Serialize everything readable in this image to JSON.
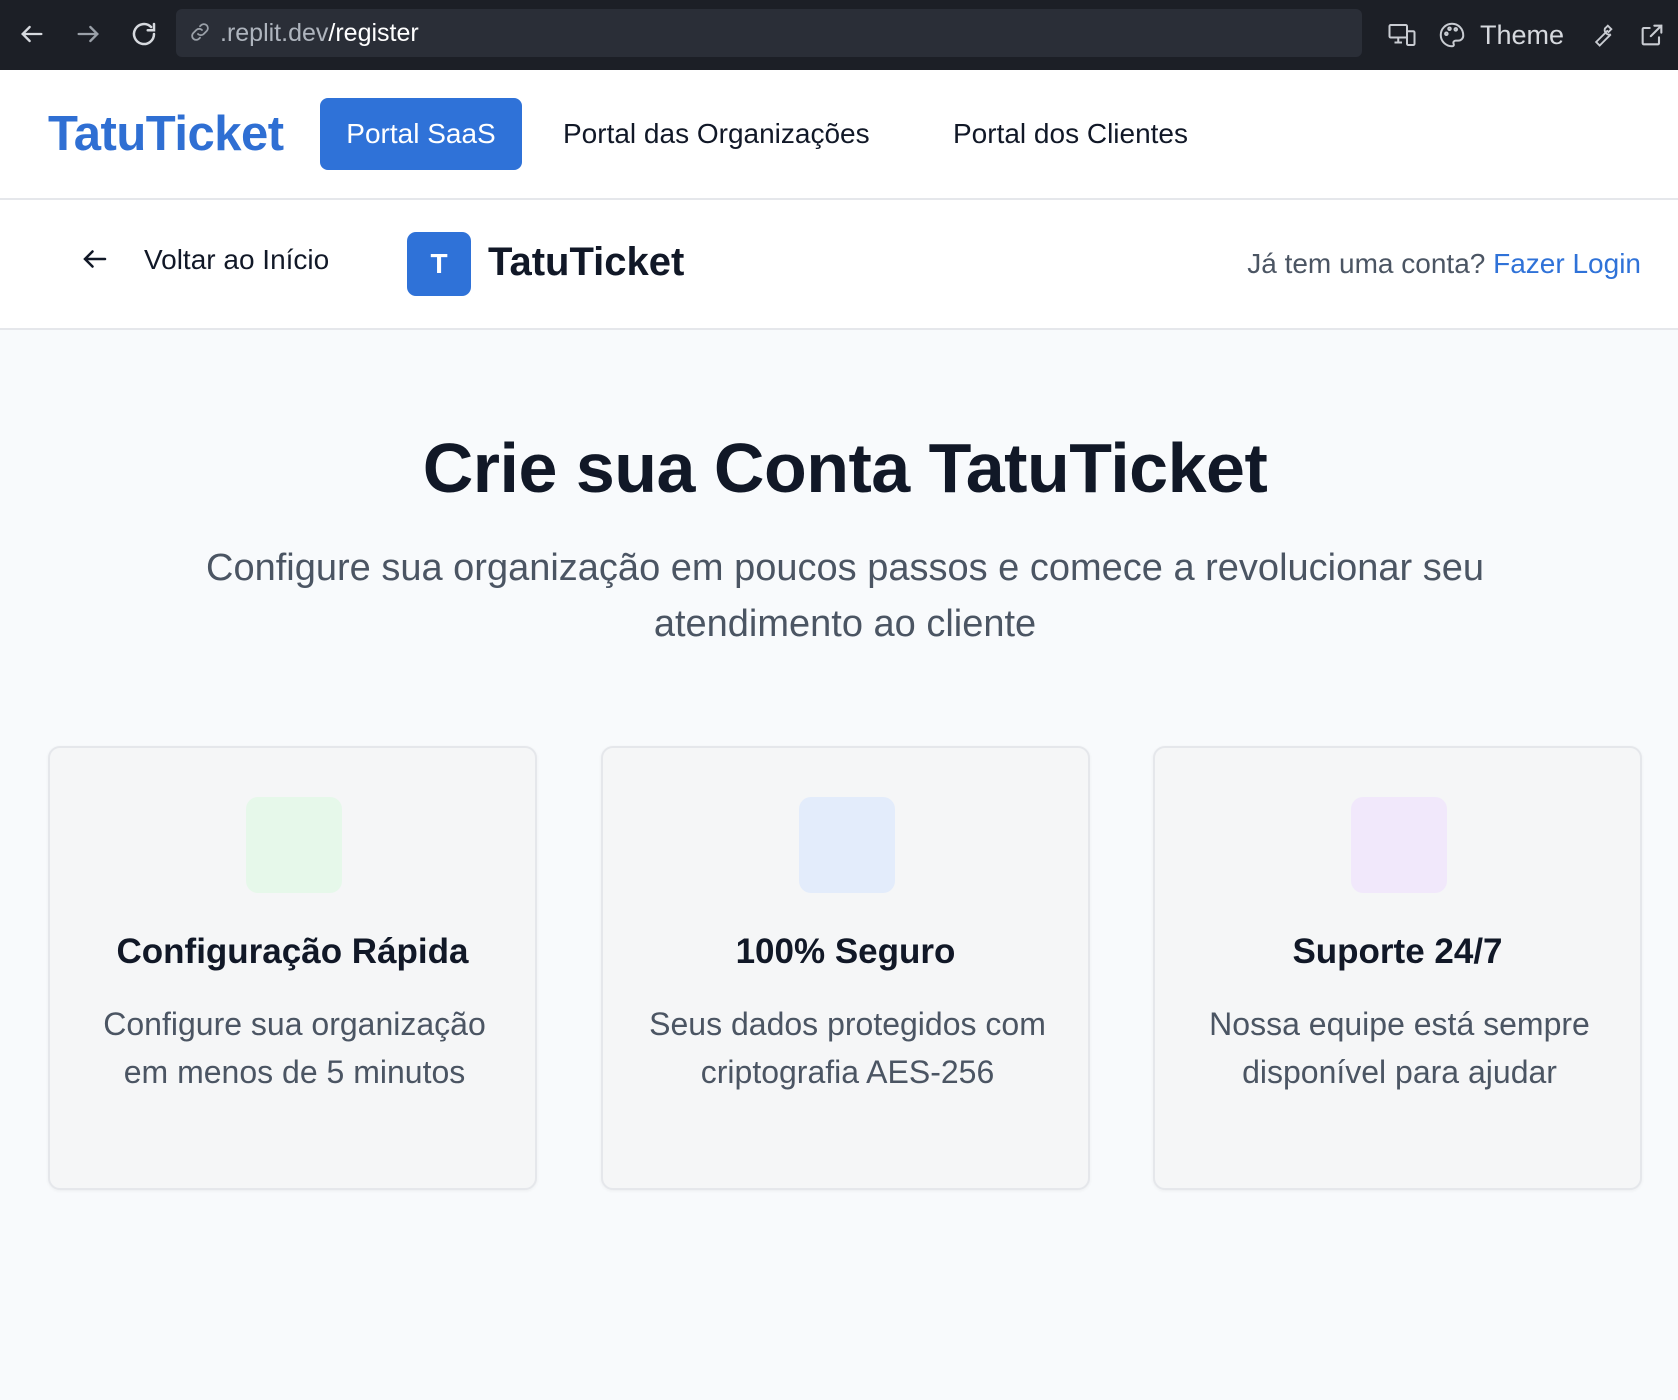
{
  "browser": {
    "url_host": ".replit.dev",
    "url_path": "/register",
    "theme_label": "Theme"
  },
  "topnav": {
    "brand": "TatuTicket",
    "tabs": [
      {
        "label": "Portal SaaS",
        "active": true
      },
      {
        "label": "Portal das Organizações",
        "active": false
      },
      {
        "label": "Portal dos Clientes",
        "active": false
      }
    ]
  },
  "subheader": {
    "back_label": "Voltar ao Início",
    "logo_letter": "T",
    "logo_text": "TatuTicket",
    "login_prompt": "Já tem uma conta?",
    "login_link": "Fazer Login"
  },
  "hero": {
    "title": "Crie sua Conta TatuTicket",
    "subtitle": "Configure sua organização em poucos passos e comece a revolucionar seu atendimento ao cliente"
  },
  "features": [
    {
      "title": "Configuração Rápida",
      "text": "Configure sua organização em menos de 5 minutos",
      "icon_bg": "#e6f8ea"
    },
    {
      "title": "100% Seguro",
      "text": "Seus dados protegidos com criptografia AES-256",
      "icon_bg": "#e3ecfb"
    },
    {
      "title": "Suporte 24/7",
      "text": "Nossa equipe está sempre disponível para ajudar",
      "icon_bg": "#f1e8fb"
    }
  ],
  "colors": {
    "accent": "#2f72d8",
    "brand": "#2f6fd3"
  }
}
